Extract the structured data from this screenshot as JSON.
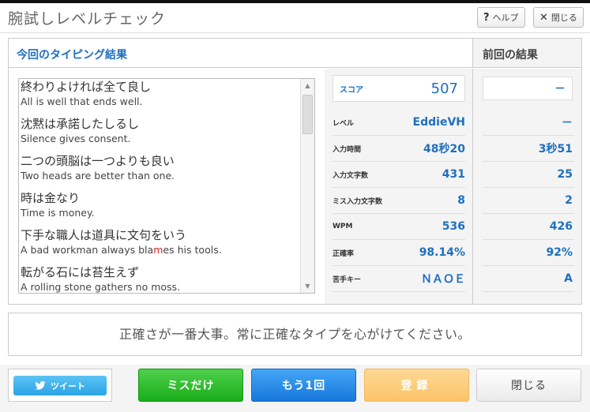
{
  "header": {
    "title": "腕試しレベルチェック",
    "help_label": "ヘルプ",
    "close_label": "閉じる"
  },
  "panel": {
    "current_title": "今回のタイピング結果",
    "previous_title": "前回の結果"
  },
  "sentences": [
    {
      "jp": "終わりよければ全て良し",
      "en": "All is well that ends well."
    },
    {
      "jp": "沈黙は承諾したしるし",
      "en": "Silence gives consent."
    },
    {
      "jp": "二つの頭脳は一つよりも良い",
      "en": "Two heads are better than one."
    },
    {
      "jp": "時は金なり",
      "en": "Time is money."
    },
    {
      "jp": "下手な職人は道具に文句をいう",
      "en": "A bad workman always blames his tools."
    },
    {
      "jp": "転がる石には苔生えず",
      "en": "A rolling stone gathers no moss."
    }
  ],
  "stats": {
    "score": {
      "label": "スコア",
      "value": "507",
      "previous": "－"
    },
    "level": {
      "label": "レベル",
      "value": "EddieVH",
      "previous": "－"
    },
    "input_time": {
      "label": "入力時間",
      "value": "48秒20",
      "previous": "3秒51"
    },
    "chars": {
      "label": "入力文字数",
      "value": "431",
      "previous": "25"
    },
    "misses": {
      "label": "ミス入力文字数",
      "value": "8",
      "previous": "2"
    },
    "wpm": {
      "label": "WPM",
      "value": "536",
      "previous": "426"
    },
    "accuracy": {
      "label": "正確率",
      "value": "98.14%",
      "previous": "92%"
    },
    "weak_keys": {
      "label": "苦手キー",
      "value": "ＮＡＯＥ",
      "previous": "A"
    }
  },
  "message": "正確さが一番大事。常に正確なタイプを心がけてください。",
  "buttons": {
    "tweet": "ツイート",
    "miss_only": "ミスだけ",
    "retry": "もう1回",
    "register": "登録",
    "close": "閉じる"
  },
  "colors": {
    "accent": "#1e6fc0",
    "miss_char": "#e0201a",
    "green": "#19ad1a",
    "blue": "#1777dc",
    "orange": "#fbc46a",
    "twitter": "#2aa3e6"
  }
}
